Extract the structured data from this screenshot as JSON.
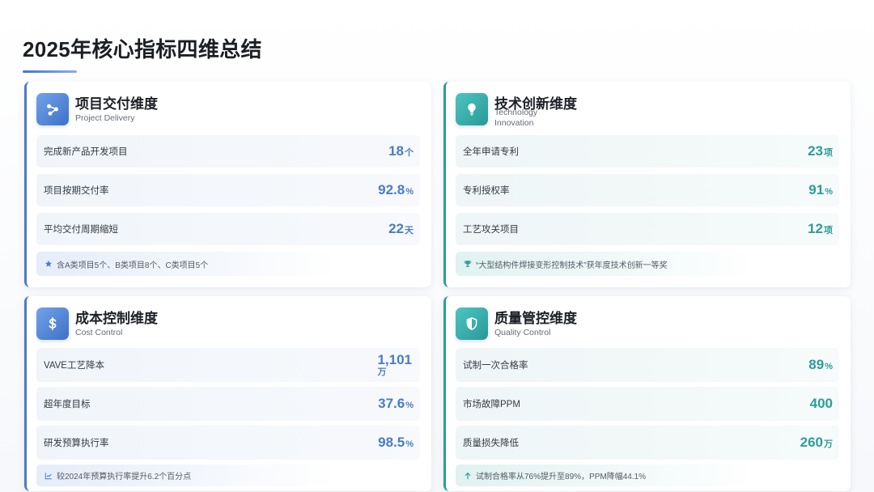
{
  "page": {
    "title": "2025年核心指标四维总结"
  },
  "theme": {
    "blue-accent": "#4a7cc2",
    "teal-accent": "#2b9d98",
    "title-underline": "#3f78d0"
  },
  "cards": [
    {
      "title": "项目交付维度",
      "subtitle": "Project Delivery",
      "icon": "share-nodes-icon",
      "accent": "#4a7cc2",
      "metrics": [
        {
          "label": "完成新产品开发项目",
          "value": "18",
          "unit": "个"
        },
        {
          "label": "项目按期交付率",
          "value": "92.8",
          "unit": "%"
        },
        {
          "label": "平均交付周期缩短",
          "value": "22",
          "unit": "天"
        }
      ],
      "note": {
        "icon": "star-icon",
        "text": "含A类项目5个、B类项目8个、C类项目5个"
      }
    },
    {
      "title": "技术创新维度",
      "subtitle": "Technology Innovation",
      "icon": "lightbulb-icon",
      "accent": "#2b9d98",
      "metrics": [
        {
          "label": "全年申请专利",
          "value": "23",
          "unit": "项"
        },
        {
          "label": "专利授权率",
          "value": "91",
          "unit": "%"
        },
        {
          "label": "工艺攻关项目",
          "value": "12",
          "unit": "项"
        }
      ],
      "note": {
        "icon": "trophy-icon",
        "text": "“大型结构件焊接变形控制技术”获年度技术创新一等奖"
      }
    },
    {
      "title": "成本控制维度",
      "subtitle": "Cost Control",
      "icon": "dollar-icon",
      "accent": "#4a7cc2",
      "metrics": [
        {
          "label": "VAVE工艺降本",
          "value": "1,101",
          "unit": "万"
        },
        {
          "label": "超年度目标",
          "value": "37.6",
          "unit": "%"
        },
        {
          "label": "研发预算执行率",
          "value": "98.5",
          "unit": "%"
        }
      ],
      "note": {
        "icon": "chart-line-icon",
        "text": "较2024年预算执行率提升6.2个百分点"
      }
    },
    {
      "title": "质量管控维度",
      "subtitle": "Quality Control",
      "icon": "shield-icon",
      "accent": "#2b9d98",
      "metrics": [
        {
          "label": "试制一次合格率",
          "value": "89",
          "unit": "%"
        },
        {
          "label": "市场故障PPM",
          "value": "400"
        },
        {
          "label": "质量损失降低",
          "value": "260",
          "unit": "万"
        }
      ],
      "note": {
        "icon": "arrow-up-icon",
        "text": "试制合格率从76%提升至89%，PPM降幅44.1%"
      }
    }
  ]
}
